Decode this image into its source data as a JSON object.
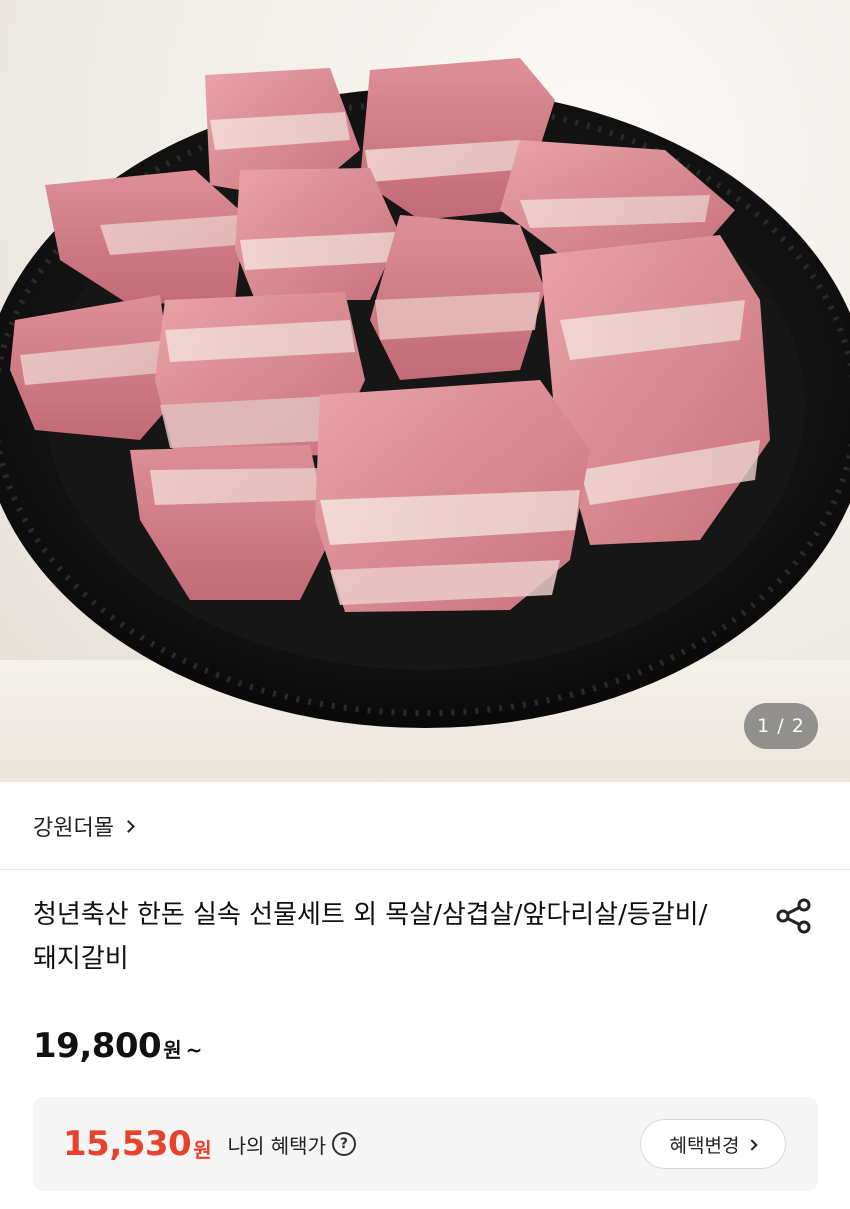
{
  "gallery": {
    "image_alt": "product-photo-pork-ribs-on-black-plate",
    "counter": "1 / 2"
  },
  "seller": {
    "name": "강원더몰",
    "chevron_icon": "chevron-right-icon"
  },
  "product": {
    "title": "청년축산 한돈 실속 선물세트 외 목살/삼겹살/앞다리살/등갈비/돼지갈비",
    "share_icon": "share-icon"
  },
  "price": {
    "amount": "19,800",
    "unit": "원",
    "suffix": "~"
  },
  "benefit": {
    "amount": "15,530",
    "unit": "원",
    "label": "나의 혜택가",
    "help_icon": "help-icon",
    "help_glyph": "?",
    "change_label": "혜택변경",
    "accent_color": "#e8412c"
  }
}
